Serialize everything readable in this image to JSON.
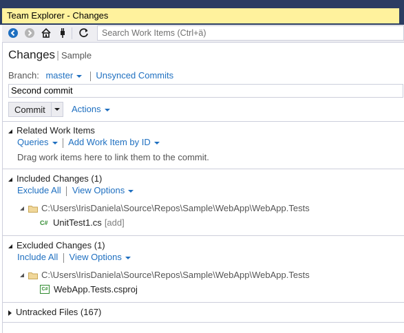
{
  "window": {
    "title": "Team Explorer - Changes"
  },
  "toolbar": {
    "search_placeholder": "Search Work Items (Ctrl+ä)"
  },
  "page": {
    "title": "Changes",
    "subtitle": "Sample"
  },
  "branch": {
    "label": "Branch:",
    "name": "master",
    "unsynced_label": "Unsynced Commits"
  },
  "commit": {
    "message": "Second commit",
    "button_label": "Commit",
    "actions_label": "Actions"
  },
  "related": {
    "title": "Related Work Items",
    "queries_label": "Queries",
    "add_label": "Add Work Item by ID",
    "hint": "Drag work items here to link them to the commit."
  },
  "included": {
    "title": "Included Changes (1)",
    "exclude_all": "Exclude All",
    "view_options": "View Options",
    "path": "C:\\Users\\IrisDaniela\\Source\\Repos\\Sample\\WebApp\\WebApp.Tests",
    "file_name": "UnitTest1.cs",
    "file_status": "[add]",
    "file_icon": "C#"
  },
  "excluded": {
    "title": "Excluded Changes (1)",
    "include_all": "Include All",
    "view_options": "View Options",
    "path": "C:\\Users\\IrisDaniela\\Source\\Repos\\Sample\\WebApp\\WebApp.Tests",
    "file_name": "WebApp.Tests.csproj",
    "file_icon": "C#"
  },
  "untracked": {
    "title": "Untracked Files (167)"
  },
  "colors": {
    "link": "#1e6fc0",
    "titlebar_active": "#fff29d",
    "frame": "#2b3d62"
  }
}
